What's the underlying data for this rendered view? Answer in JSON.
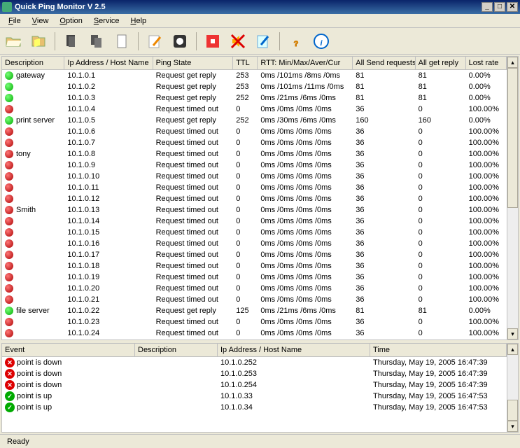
{
  "window": {
    "title": "Quick Ping Monitor V 2.5"
  },
  "menu": [
    "File",
    "View",
    "Option",
    "Service",
    "Help"
  ],
  "columns": {
    "desc": "Description",
    "ip": "Ip Address / Host Name",
    "state": "Ping State",
    "ttl": "TTL",
    "rtt": "RTT: Min/Max/Aver/Cur",
    "send": "All Send requests",
    "reply": "All get reply",
    "lost": "Lost rate"
  },
  "rows": [
    {
      "s": "g",
      "desc": "gateway",
      "ip": "10.1.0.1",
      "state": "Request get reply",
      "ttl": "253",
      "rtt": "0ms /101ms /8ms /0ms",
      "send": "81",
      "reply": "81",
      "lost": "0.00%"
    },
    {
      "s": "g",
      "desc": "",
      "ip": "10.1.0.2",
      "state": "Request get reply",
      "ttl": "253",
      "rtt": "0ms /101ms /11ms /0ms",
      "send": "81",
      "reply": "81",
      "lost": "0.00%"
    },
    {
      "s": "g",
      "desc": "",
      "ip": "10.1.0.3",
      "state": "Request get reply",
      "ttl": "252",
      "rtt": "0ms /21ms /6ms /0ms",
      "send": "81",
      "reply": "81",
      "lost": "0.00%"
    },
    {
      "s": "r",
      "desc": "",
      "ip": "10.1.0.4",
      "state": "Request timed out",
      "ttl": "0",
      "rtt": "0ms /0ms /0ms /0ms",
      "send": "36",
      "reply": "0",
      "lost": "100.00%"
    },
    {
      "s": "g",
      "desc": "print server",
      "ip": "10.1.0.5",
      "state": "Request get reply",
      "ttl": "252",
      "rtt": "0ms /30ms /6ms /0ms",
      "send": "160",
      "reply": "160",
      "lost": "0.00%"
    },
    {
      "s": "r",
      "desc": "",
      "ip": "10.1.0.6",
      "state": "Request timed out",
      "ttl": "0",
      "rtt": "0ms /0ms /0ms /0ms",
      "send": "36",
      "reply": "0",
      "lost": "100.00%"
    },
    {
      "s": "r",
      "desc": "",
      "ip": "10.1.0.7",
      "state": "Request timed out",
      "ttl": "0",
      "rtt": "0ms /0ms /0ms /0ms",
      "send": "36",
      "reply": "0",
      "lost": "100.00%"
    },
    {
      "s": "r",
      "desc": "tony",
      "ip": "10.1.0.8",
      "state": "Request timed out",
      "ttl": "0",
      "rtt": "0ms /0ms /0ms /0ms",
      "send": "36",
      "reply": "0",
      "lost": "100.00%"
    },
    {
      "s": "r",
      "desc": "",
      "ip": "10.1.0.9",
      "state": "Request timed out",
      "ttl": "0",
      "rtt": "0ms /0ms /0ms /0ms",
      "send": "36",
      "reply": "0",
      "lost": "100.00%"
    },
    {
      "s": "r",
      "desc": "",
      "ip": "10.1.0.10",
      "state": "Request timed out",
      "ttl": "0",
      "rtt": "0ms /0ms /0ms /0ms",
      "send": "36",
      "reply": "0",
      "lost": "100.00%"
    },
    {
      "s": "r",
      "desc": "",
      "ip": "10.1.0.11",
      "state": "Request timed out",
      "ttl": "0",
      "rtt": "0ms /0ms /0ms /0ms",
      "send": "36",
      "reply": "0",
      "lost": "100.00%"
    },
    {
      "s": "r",
      "desc": "",
      "ip": "10.1.0.12",
      "state": "Request timed out",
      "ttl": "0",
      "rtt": "0ms /0ms /0ms /0ms",
      "send": "36",
      "reply": "0",
      "lost": "100.00%"
    },
    {
      "s": "r",
      "desc": "Smith",
      "ip": "10.1.0.13",
      "state": "Request timed out",
      "ttl": "0",
      "rtt": "0ms /0ms /0ms /0ms",
      "send": "36",
      "reply": "0",
      "lost": "100.00%"
    },
    {
      "s": "r",
      "desc": "",
      "ip": "10.1.0.14",
      "state": "Request timed out",
      "ttl": "0",
      "rtt": "0ms /0ms /0ms /0ms",
      "send": "36",
      "reply": "0",
      "lost": "100.00%"
    },
    {
      "s": "r",
      "desc": "",
      "ip": "10.1.0.15",
      "state": "Request timed out",
      "ttl": "0",
      "rtt": "0ms /0ms /0ms /0ms",
      "send": "36",
      "reply": "0",
      "lost": "100.00%"
    },
    {
      "s": "r",
      "desc": "",
      "ip": "10.1.0.16",
      "state": "Request timed out",
      "ttl": "0",
      "rtt": "0ms /0ms /0ms /0ms",
      "send": "36",
      "reply": "0",
      "lost": "100.00%"
    },
    {
      "s": "r",
      "desc": "",
      "ip": "10.1.0.17",
      "state": "Request timed out",
      "ttl": "0",
      "rtt": "0ms /0ms /0ms /0ms",
      "send": "36",
      "reply": "0",
      "lost": "100.00%"
    },
    {
      "s": "r",
      "desc": "",
      "ip": "10.1.0.18",
      "state": "Request timed out",
      "ttl": "0",
      "rtt": "0ms /0ms /0ms /0ms",
      "send": "36",
      "reply": "0",
      "lost": "100.00%"
    },
    {
      "s": "r",
      "desc": "",
      "ip": "10.1.0.19",
      "state": "Request timed out",
      "ttl": "0",
      "rtt": "0ms /0ms /0ms /0ms",
      "send": "36",
      "reply": "0",
      "lost": "100.00%"
    },
    {
      "s": "r",
      "desc": "",
      "ip": "10.1.0.20",
      "state": "Request timed out",
      "ttl": "0",
      "rtt": "0ms /0ms /0ms /0ms",
      "send": "36",
      "reply": "0",
      "lost": "100.00%"
    },
    {
      "s": "r",
      "desc": "",
      "ip": "10.1.0.21",
      "state": "Request timed out",
      "ttl": "0",
      "rtt": "0ms /0ms /0ms /0ms",
      "send": "36",
      "reply": "0",
      "lost": "100.00%"
    },
    {
      "s": "g",
      "desc": "file server",
      "ip": "10.1.0.22",
      "state": "Request get reply",
      "ttl": "125",
      "rtt": "0ms /21ms /6ms /0ms",
      "send": "81",
      "reply": "81",
      "lost": "0.00%"
    },
    {
      "s": "r",
      "desc": "",
      "ip": "10.1.0.23",
      "state": "Request timed out",
      "ttl": "0",
      "rtt": "0ms /0ms /0ms /0ms",
      "send": "36",
      "reply": "0",
      "lost": "100.00%"
    },
    {
      "s": "r",
      "desc": "",
      "ip": "10.1.0.24",
      "state": "Request timed out",
      "ttl": "0",
      "rtt": "0ms /0ms /0ms /0ms",
      "send": "36",
      "reply": "0",
      "lost": "100.00%"
    }
  ],
  "eventcols": {
    "evt": "Event",
    "desc": "Description",
    "ip": "Ip Address / Host Name",
    "time": "Time"
  },
  "events": [
    {
      "s": "down",
      "evt": "point is down",
      "desc": "",
      "ip": "10.1.0.252",
      "time": "Thursday, May 19, 2005  16:47:39"
    },
    {
      "s": "down",
      "evt": "point is down",
      "desc": "",
      "ip": "10.1.0.253",
      "time": "Thursday, May 19, 2005  16:47:39"
    },
    {
      "s": "down",
      "evt": "point is down",
      "desc": "",
      "ip": "10.1.0.254",
      "time": "Thursday, May 19, 2005  16:47:39"
    },
    {
      "s": "up",
      "evt": "point is up",
      "desc": "",
      "ip": "10.1.0.33",
      "time": "Thursday, May 19, 2005  16:47:53"
    },
    {
      "s": "up",
      "evt": "point is up",
      "desc": "",
      "ip": "10.1.0.34",
      "time": "Thursday, May 19, 2005  16:47:53"
    }
  ],
  "status": "Ready"
}
